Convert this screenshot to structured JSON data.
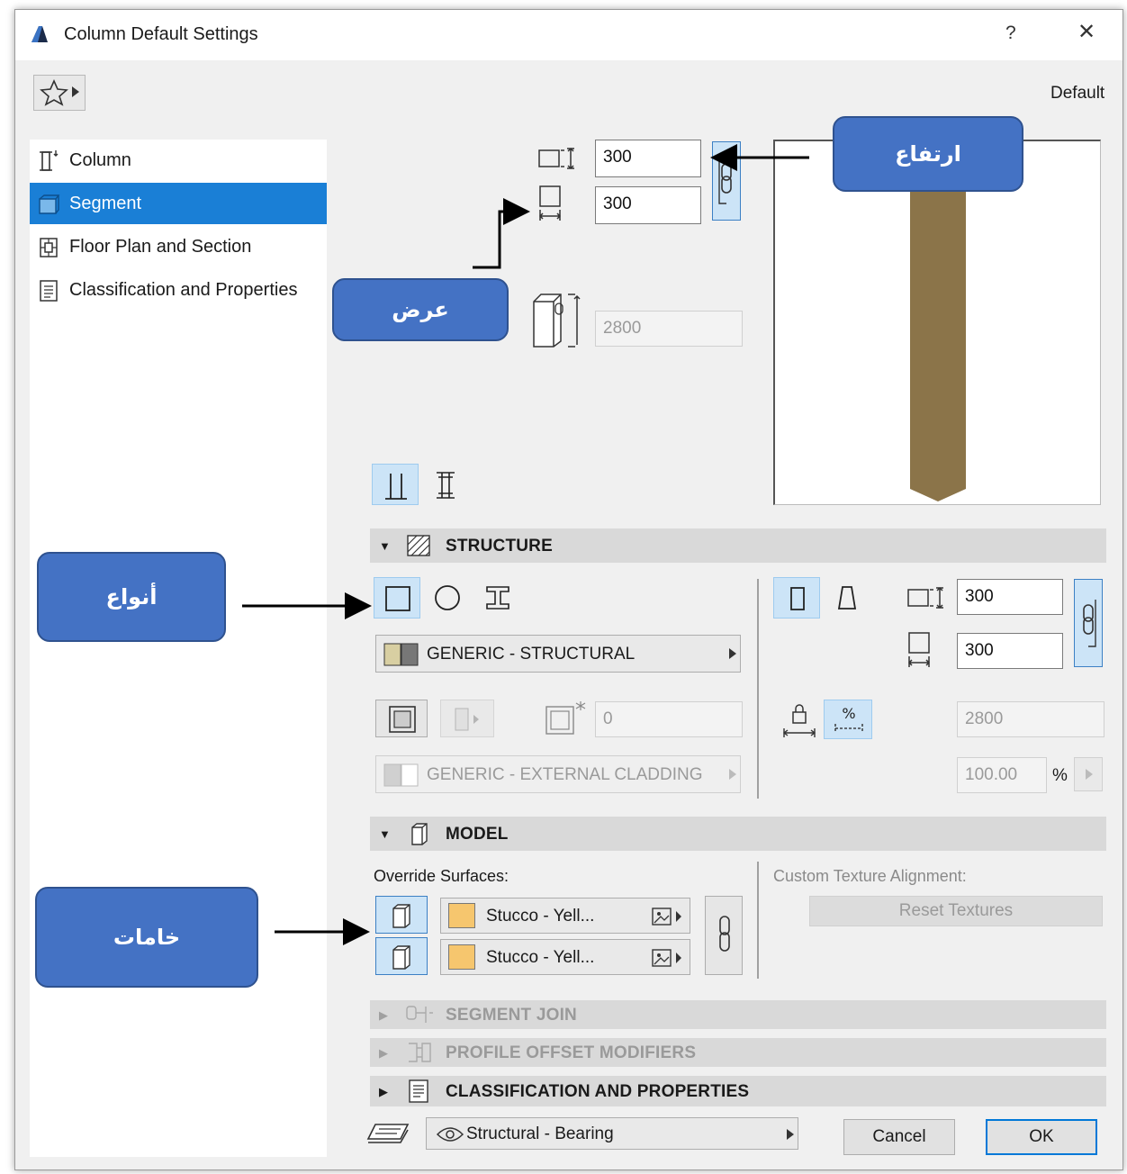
{
  "window": {
    "title": "Column Default Settings",
    "help_glyph": "?",
    "close_glyph": "✕"
  },
  "favorites": {
    "label": "Default"
  },
  "nav": {
    "items": [
      {
        "label": "Column",
        "icon": "column-icon"
      },
      {
        "label": "Segment",
        "icon": "segment-icon",
        "selected": true
      },
      {
        "label": "Floor Plan and Section",
        "icon": "floor-plan-icon"
      },
      {
        "label": "Classification and Properties",
        "icon": "document-icon"
      }
    ]
  },
  "top": {
    "height_value": "300",
    "width_value": "300",
    "segment_height_value": "2800"
  },
  "structure": {
    "title": "STRUCTURE",
    "building_material": "GENERIC - STRUCTURAL",
    "veneer_thickness": "0",
    "veneer_material": "GENERIC - EXTERNAL CLADDING",
    "end_height_value": "300",
    "end_width_value": "300",
    "length_value": "2800",
    "percent_value": "100.00",
    "percent_unit": "%"
  },
  "model": {
    "title": "MODEL",
    "override_label": "Override Surfaces:",
    "surface_1": "Stucco - Yell...",
    "surface_2": "Stucco - Yell...",
    "custom_texture_label": "Custom Texture Alignment:",
    "reset_textures_label": "Reset Textures",
    "surface_color": "#f6c66e"
  },
  "collapsed_sections": {
    "segment_join": "SEGMENT JOIN",
    "profile_offset": "PROFILE OFFSET MODIFIERS",
    "classification": "CLASSIFICATION AND PROPERTIES"
  },
  "footer": {
    "layer_value": "Structural - Bearing",
    "cancel_label": "Cancel",
    "ok_label": "OK"
  },
  "callouts": {
    "height": "ارتفاع",
    "width": "عرض",
    "types": "أنواع",
    "materials": "خامات"
  },
  "colors": {
    "accent": "#1a7fd6",
    "callout_fill": "#4472c4",
    "column_preview": "#8b7449"
  }
}
